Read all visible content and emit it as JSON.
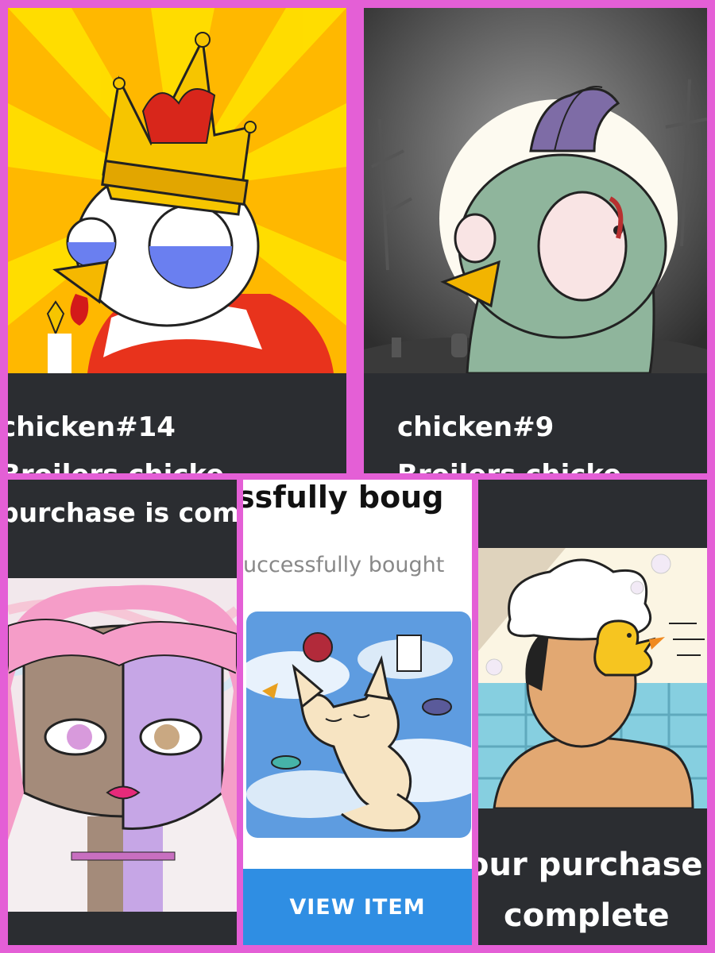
{
  "collage": {
    "border_color": "#e45fd6",
    "panels": [
      {
        "title": "chicken#14",
        "subtitle": "Broilers chicke",
        "art": "king-chicken-illustration"
      },
      {
        "title": "chicken#9",
        "subtitle": "Broilers chicke",
        "art": "zombie-chicken-illustration"
      },
      {
        "heading": "purchase is com",
        "art": "pink-hair-girl-illustration"
      },
      {
        "heading": "ssfully boug",
        "subheading": "uccessfully bought",
        "art": "sleeping-cat-illustration",
        "button_label": "VIEW ITEM",
        "button_color": "#2f8ee3"
      },
      {
        "heading": "our purchase",
        "heading2": "complete",
        "art": "shower-boy-duck-illustration"
      }
    ]
  }
}
